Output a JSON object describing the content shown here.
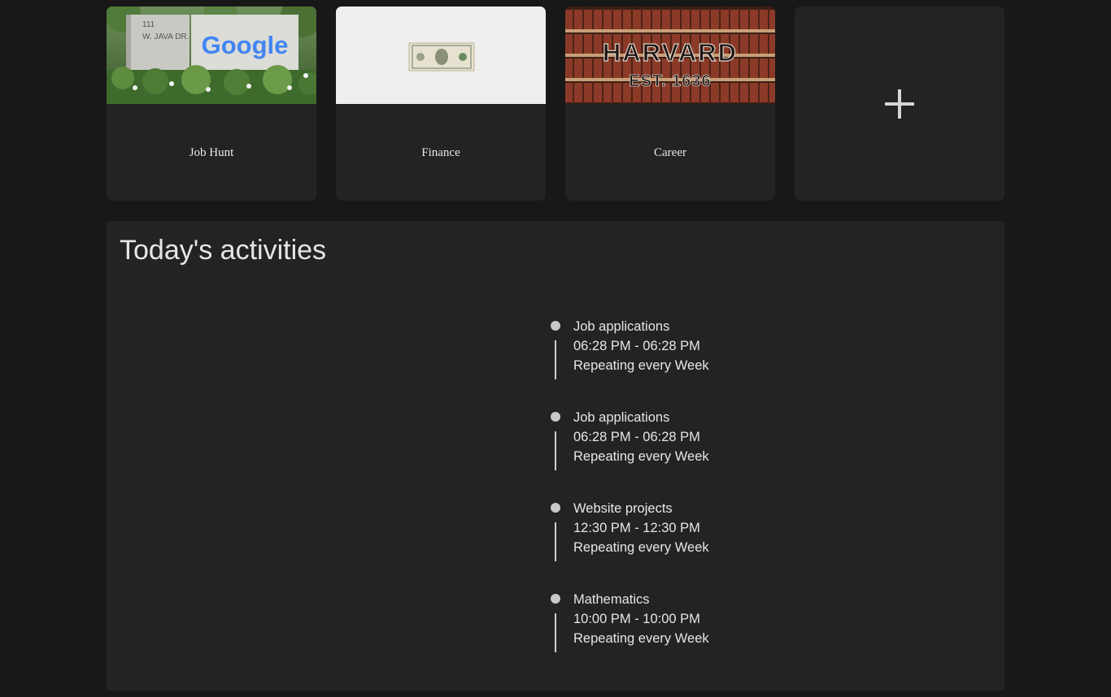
{
  "cards": [
    {
      "label": "Job Hunt",
      "image": "google-campus-sign-photo",
      "sign_number": "111",
      "sign_street": "W. JAVA DR.",
      "sign_brand": "Google"
    },
    {
      "label": "Finance",
      "image": "dollar-bill-photo"
    },
    {
      "label": "Career",
      "image": "harvard-bookshelf-photo",
      "sign_title": "HARVARD",
      "sign_est": "EST. 1636"
    }
  ],
  "add_card": {
    "icon": "plus-icon"
  },
  "activities": {
    "title": "Today's activities",
    "items": [
      {
        "name": "Job applications",
        "time": "06:28 PM - 06:28 PM",
        "repeat": "Repeating every Week"
      },
      {
        "name": "Job applications",
        "time": "06:28 PM - 06:28 PM",
        "repeat": "Repeating every Week"
      },
      {
        "name": "Website projects",
        "time": "12:30 PM - 12:30 PM",
        "repeat": "Repeating every Week"
      },
      {
        "name": "Mathematics",
        "time": "10:00 PM - 10:00 PM",
        "repeat": "Repeating every Week"
      }
    ]
  },
  "colors": {
    "page_background": "#181818",
    "panel_background": "#232323",
    "text": "#e6e6e6",
    "timeline_dot": "#c8c8c8"
  }
}
